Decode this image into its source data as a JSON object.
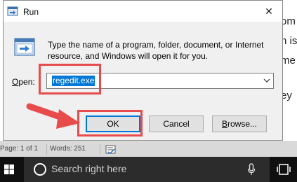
{
  "background": {
    "text_fragments": [
      "om",
      "n is",
      "me",
      "ey"
    ],
    "status_page": "Page: 1 of 1",
    "status_words": "Words: 251"
  },
  "dialog": {
    "title": "Run",
    "close_glyph": "✕",
    "description": "Type the name of a program, folder, document, or Internet resource, and Windows will open it for you.",
    "open_label_prefix": "",
    "open_label_underlined": "O",
    "open_label_rest": "pen:",
    "open_value": "regedit.exe",
    "ok_label": "OK",
    "cancel_label": "Cancel",
    "browse_label_underlined": "B",
    "browse_label_rest": "rowse..."
  },
  "taskbar": {
    "search_placeholder": "Search right here"
  },
  "annotations": {
    "highlight_color": "#e84b4b"
  },
  "icons": [
    "run-icon",
    "windows-start-icon",
    "search-circle-icon",
    "microphone-icon",
    "task-view-icon",
    "combo-arrow-icon",
    "close-icon",
    "red-arrow-icon"
  ],
  "colors": {
    "accent": "#0078d7",
    "taskbar": "#101010",
    "search_bar": "#2c2c2c"
  }
}
